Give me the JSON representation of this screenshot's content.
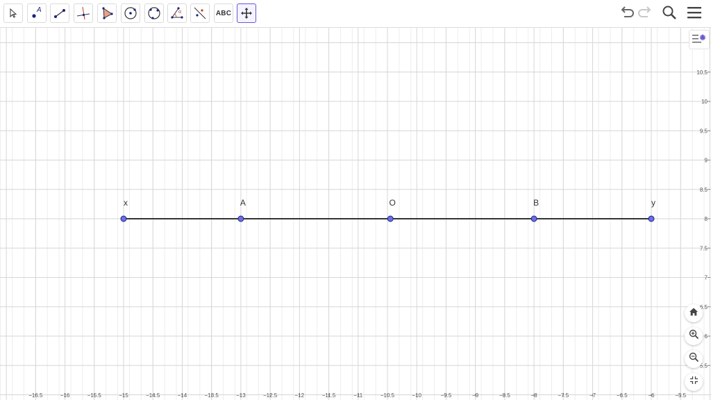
{
  "toolbar": {
    "tools": [
      {
        "name": "move-tool-icon"
      },
      {
        "name": "point-tool-icon",
        "text": "A"
      },
      {
        "name": "segment-tool-icon"
      },
      {
        "name": "perpendicular-line-tool-icon"
      },
      {
        "name": "polygon-tool-icon"
      },
      {
        "name": "circle-center-point-tool-icon"
      },
      {
        "name": "circle-three-points-tool-icon"
      },
      {
        "name": "angle-tool-icon",
        "text": "α"
      },
      {
        "name": "reflect-tool-icon"
      },
      {
        "name": "text-tool-icon",
        "text": "ABC"
      },
      {
        "name": "move-graphics-view-tool-icon"
      }
    ],
    "selected_tool": "move-graphics-view-tool-icon",
    "right": [
      "undo-icon",
      "redo-icon",
      "search-icon",
      "menu-icon"
    ]
  },
  "colors": {
    "accent": "#6557d2",
    "point_fill": "#6d6de8",
    "point_stroke": "#1a237e",
    "segment": "#333333",
    "grid_major": "#d6d6d6",
    "grid_minor": "#ededed"
  },
  "graphics": {
    "x_axis": {
      "min": -16.5,
      "max": -5.5,
      "step": 0.5,
      "labels": [
        "−16.5",
        "−16",
        "−15.5",
        "−15",
        "−14.5",
        "−14",
        "−13.5",
        "−13",
        "−12.5",
        "−12",
        "−11.5",
        "−11",
        "−10.5",
        "−10",
        "−9.5",
        "−9",
        "−8.5",
        "−8",
        "−7.5",
        "−7",
        "−6.5",
        "−6",
        "−5.5"
      ]
    },
    "y_axis": {
      "labels": [
        {
          "v": 10.5,
          "text": "10.5"
        },
        {
          "v": 10,
          "text": "10"
        },
        {
          "v": 9.5,
          "text": "9.5"
        },
        {
          "v": 9,
          "text": "9"
        },
        {
          "v": 8.5,
          "text": "8.5"
        },
        {
          "v": 8,
          "text": "8"
        },
        {
          "v": 7.5,
          "text": "7.5"
        },
        {
          "v": 7,
          "text": "7"
        },
        {
          "v": 6.5,
          "text": "6.5"
        },
        {
          "v": 6,
          "text": "6"
        },
        {
          "v": 5.5,
          "text": "5.5"
        }
      ]
    },
    "points": [
      {
        "label": "x",
        "x": -15,
        "y": 8
      },
      {
        "label": "A",
        "x": -13,
        "y": 8
      },
      {
        "label": "O",
        "x": -10.45,
        "y": 8
      },
      {
        "label": "B",
        "x": -8,
        "y": 8
      },
      {
        "label": "y",
        "x": -6,
        "y": 8
      }
    ],
    "segment": {
      "from": "x",
      "to": "y"
    }
  },
  "side_buttons": [
    "style-bar-toggle-icon",
    "home-icon",
    "zoom-in-icon",
    "zoom-out-icon",
    "fullscreen-icon"
  ]
}
